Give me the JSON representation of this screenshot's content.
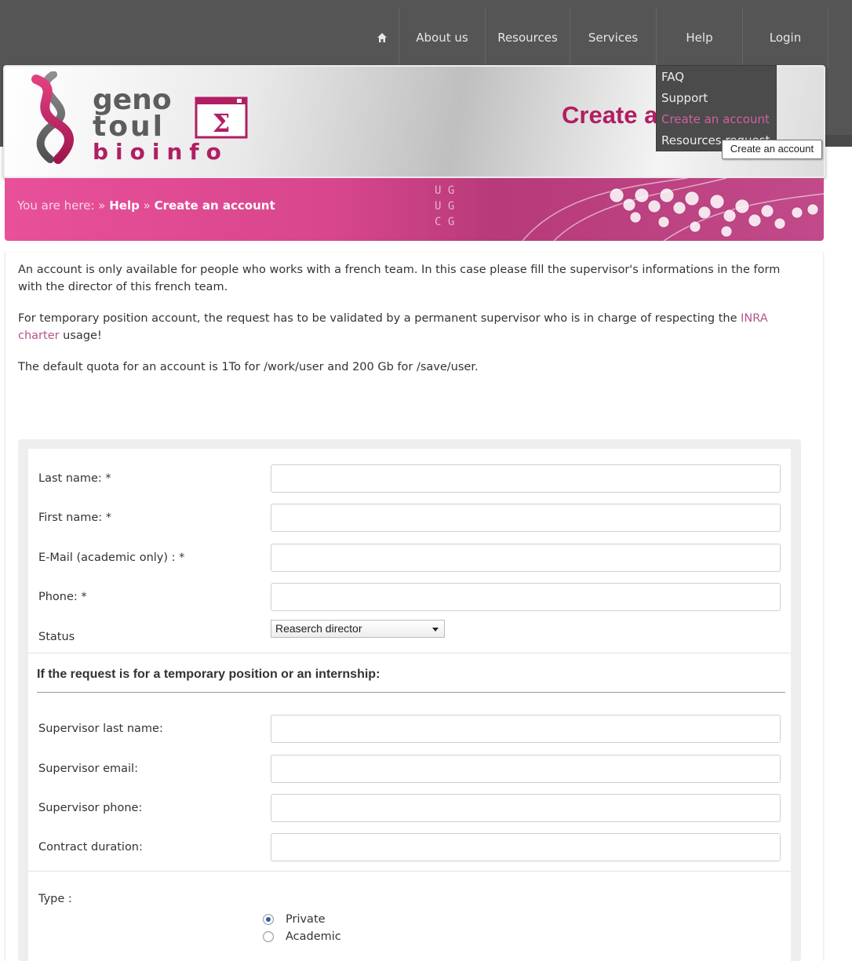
{
  "nav": {
    "items": [
      "About us",
      "Resources",
      "Services",
      "Help",
      "Login"
    ]
  },
  "help_menu": {
    "items": [
      "FAQ",
      "Support",
      "Create an account",
      "Resources request"
    ],
    "tooltip": "Create an account"
  },
  "header": {
    "logo": {
      "line1": "geno",
      "line2": "toul",
      "line3": "bioinfo",
      "symbol": "Σ"
    },
    "title": "Create an account"
  },
  "breadcrumb": {
    "prefix": "You are here: »",
    "crumb1": "Help",
    "separator": "»",
    "crumb2": "Create an account"
  },
  "intro": {
    "p1": "An account is only available for people who works with a french team. In this case please fill the supervisor's informations in the form with the director of this french team.",
    "p2_before": "For temporary position account, the request has to be validated by a permanent supervisor who is in charge of respecting the ",
    "p2_link": "INRA charter",
    "p2_after": " usage!",
    "p3": "The default quota for an account is 1To for /work/user and 200 Gb for /save/user."
  },
  "form": {
    "last_name_label": "Last name: *",
    "first_name_label": "First name: *",
    "email_label": "E-Mail (academic only) : *",
    "phone_label": "Phone: *",
    "status_label": "Status",
    "status_value": "Reaserch director",
    "temp_section_title": "If the request is for a temporary position or an internship:",
    "supervisor_last_name_label": "Supervisor last name:",
    "supervisor_email_label": "Supervisor email:",
    "supervisor_phone_label": "Supervisor phone:",
    "contract_duration_label": "Contract duration:",
    "type_label": "Type :",
    "type_options": [
      "Private",
      "Academic"
    ],
    "type_selected": "Private"
  },
  "colors": {
    "nav_bg": "#555555",
    "brand_pink": "#b11e63",
    "band_pink": "#d8468d",
    "link": "#b5548c"
  }
}
